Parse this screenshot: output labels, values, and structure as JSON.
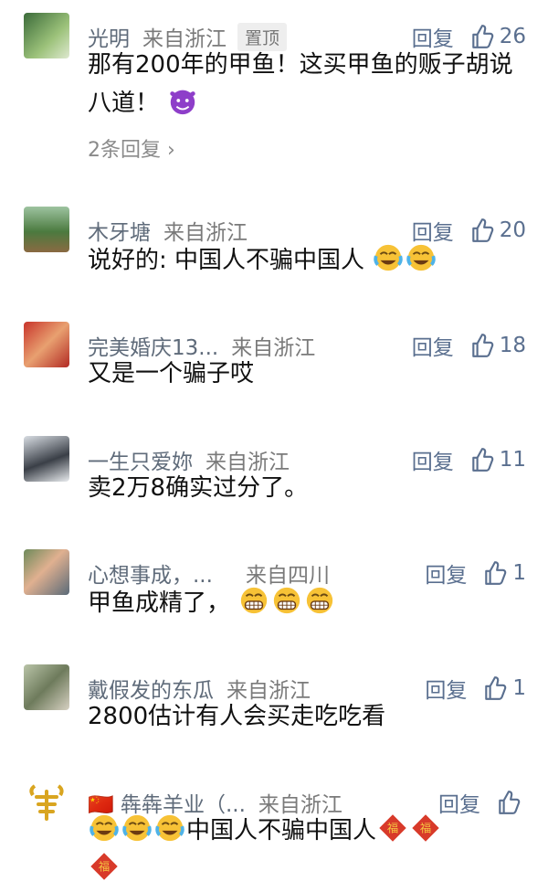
{
  "comments": [
    {
      "username": "光明",
      "location": "来自浙江",
      "pinned": "置顶",
      "reply": "回复",
      "likes": "26",
      "text": "那有200年的甲鱼！这买甲鱼的贩子胡说八道！",
      "emoji": "devil-emoji",
      "replies": "2条回复"
    },
    {
      "username": "木牙塘",
      "location": "来自浙江",
      "reply": "回复",
      "likes": "20",
      "text": "说好的: 中国人不骗中国人",
      "emoji": "crying-laughing-emoji"
    },
    {
      "username": "完美婚庆13...",
      "location": "来自浙江",
      "reply": "回复",
      "likes": "18",
      "text": "又是一个骗子哎"
    },
    {
      "username": "一生只爱妳",
      "location": "来自浙江",
      "reply": "回复",
      "likes": "11",
      "text": "卖2万8确实过分了。"
    },
    {
      "username": "心想事成，...",
      "location": "来自四川",
      "reply": "回复",
      "likes": "1",
      "text": "甲鱼成精了，",
      "emoji": "grin-emoji"
    },
    {
      "username": "戴假发的东瓜",
      "location": "来自浙江",
      "reply": "回复",
      "likes": "1",
      "text": "2800估计有人会买走吃吃看"
    },
    {
      "username": "🇨🇳 犇犇羊业（...",
      "location": "来自浙江",
      "reply": "回复",
      "likes": "",
      "text": "中国人不骗中国人",
      "emoji": "fu-emoji"
    }
  ],
  "colors": {
    "username": "#5f6b7a",
    "action": "#5a6f8f",
    "text": "#111111"
  }
}
